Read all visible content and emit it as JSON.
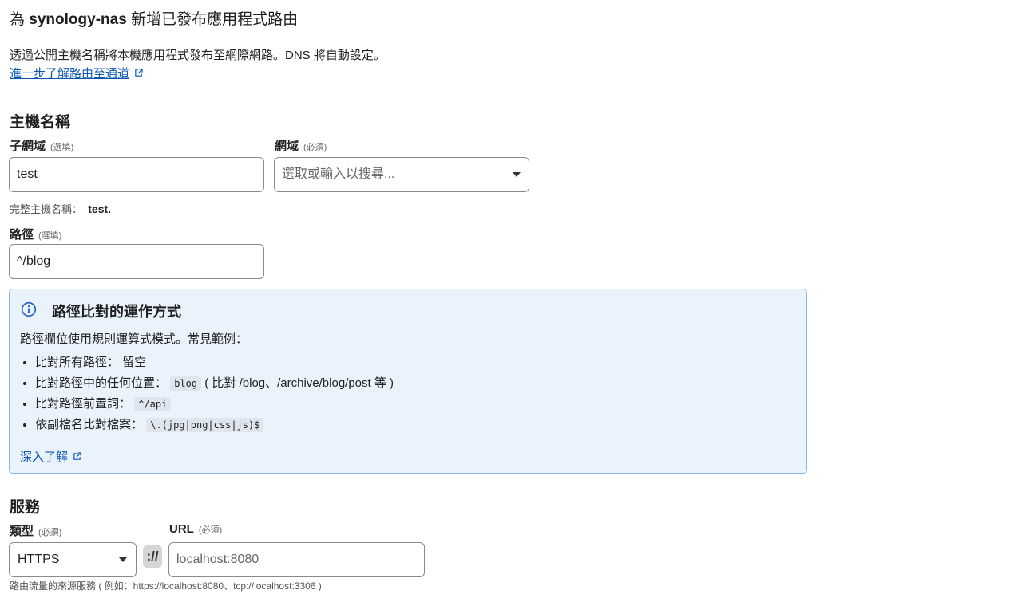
{
  "header": {
    "title_prefix": "為",
    "title_host": "synology-nas",
    "title_suffix": "新增已發布應用程式路由",
    "description": "透過公開主機名稱將本機應用程式發布至網際網路。DNS 將自動設定。",
    "learn_link": "進一步了解路由至通道"
  },
  "hostname": {
    "section_title": "主機名稱",
    "subdomain": {
      "label": "子網域",
      "hint": "(選填)",
      "value": "test"
    },
    "domain": {
      "label": "網域",
      "hint": "(必須)",
      "placeholder": "選取或輸入以搜尋..."
    },
    "full_label": "完整主機名稱：",
    "full_value": "test.",
    "path": {
      "label": "路徑",
      "hint": "(選填)",
      "value": "^/blog"
    }
  },
  "info_box": {
    "icon": "info-icon",
    "title": "路徑比對的運作方式",
    "intro": "路徑欄位使用規則運算式模式。常見範例：",
    "items": [
      {
        "text": "比對所有路徑：",
        "code": "",
        "after": "留空"
      },
      {
        "text": "比對路徑中的任何位置：",
        "code": "blog",
        "after": "( 比對 /blog、/archive/blog/post 等 )"
      },
      {
        "text": "比對路徑前置詞：",
        "code": "^/api",
        "after": ""
      },
      {
        "text": "依副檔名比對檔案：",
        "code": "\\.(jpg|png|css|js)$",
        "after": ""
      }
    ],
    "more_link": "深入了解"
  },
  "service": {
    "section_title": "服務",
    "type": {
      "label": "類型",
      "hint": "(必須)",
      "value": "HTTPS"
    },
    "separator": "://",
    "url": {
      "label": "URL",
      "hint": "(必須)",
      "placeholder": "localhost:8080"
    },
    "help": "路由流量的來源服務 ( 例如：https://localhost:8080、tcp://localhost:3306 )"
  },
  "colors": {
    "link": "#0b57b0",
    "info_bg": "#eaf2fc",
    "info_border": "#8fb3e8"
  }
}
